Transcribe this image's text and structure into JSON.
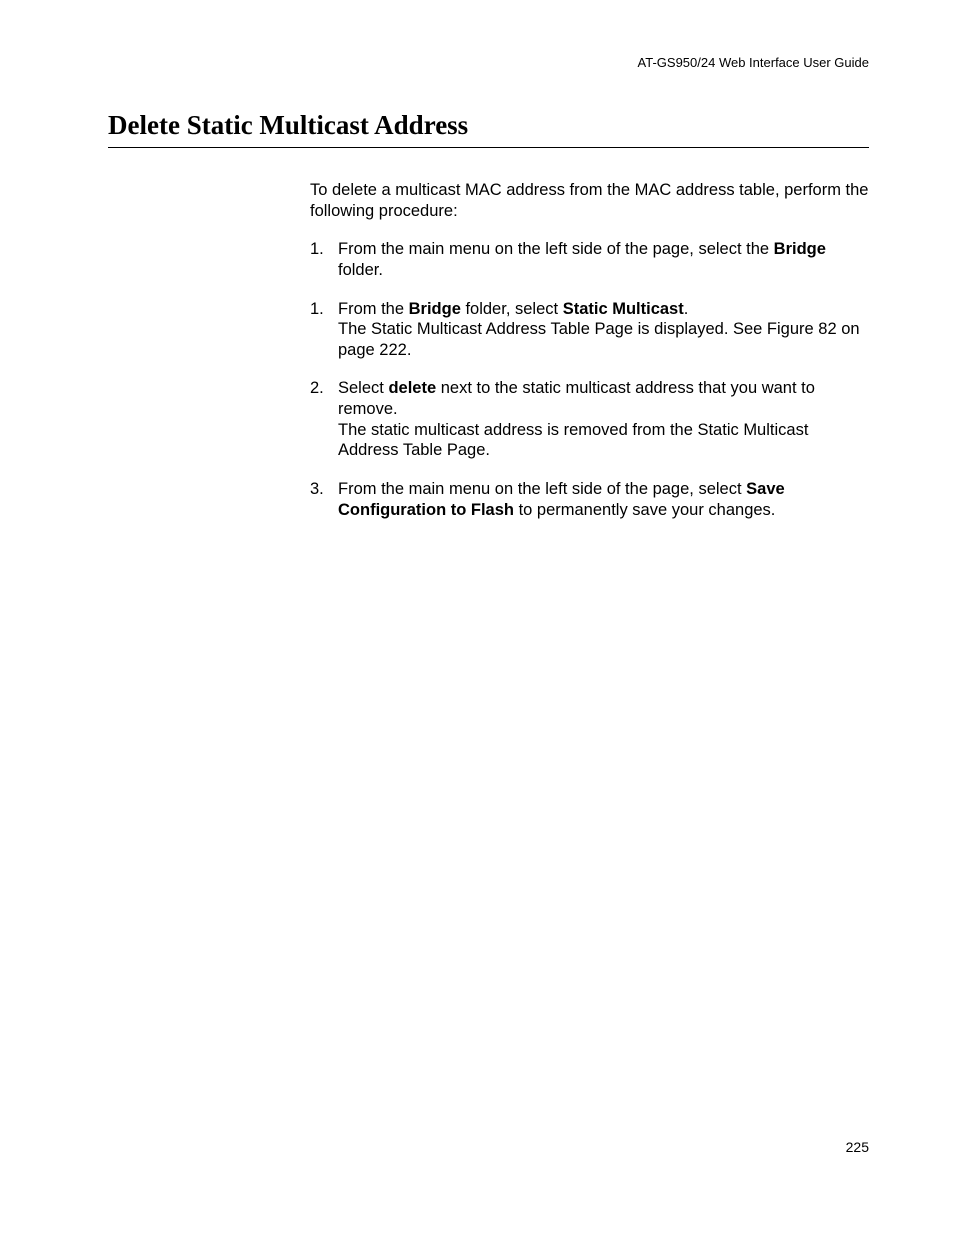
{
  "header": "AT-GS950/24  Web Interface User Guide",
  "title": "Delete Static Multicast Address",
  "intro": "To delete a multicast MAC address from the MAC address table, perform the following procedure:",
  "steps": [
    {
      "num": "1.",
      "parts": [
        {
          "t": "From the main menu on the left side of the page, select the "
        },
        {
          "t": "Bridge",
          "b": true
        },
        {
          "t": " folder."
        }
      ]
    },
    {
      "num": "1.",
      "parts": [
        {
          "t": "From the "
        },
        {
          "t": "Bridge",
          "b": true
        },
        {
          "t": " folder, select "
        },
        {
          "t": "Static Multicast",
          "b": true
        },
        {
          "t": "."
        }
      ],
      "sub": "The Static Multicast Address Table Page is displayed. See Figure 82 on page 222."
    },
    {
      "num": "2.",
      "parts": [
        {
          "t": "Select "
        },
        {
          "t": "delete",
          "b": true
        },
        {
          "t": " next to the static multicast address that you want to remove."
        }
      ],
      "sub": "The static multicast address is removed from the Static Multicast Address Table Page."
    },
    {
      "num": "3.",
      "parts": [
        {
          "t": "From the main menu on the left side of the page, select "
        },
        {
          "t": "Save Configuration to Flash",
          "b": true
        },
        {
          "t": " to permanently save your changes."
        }
      ]
    }
  ],
  "pageNumber": "225"
}
